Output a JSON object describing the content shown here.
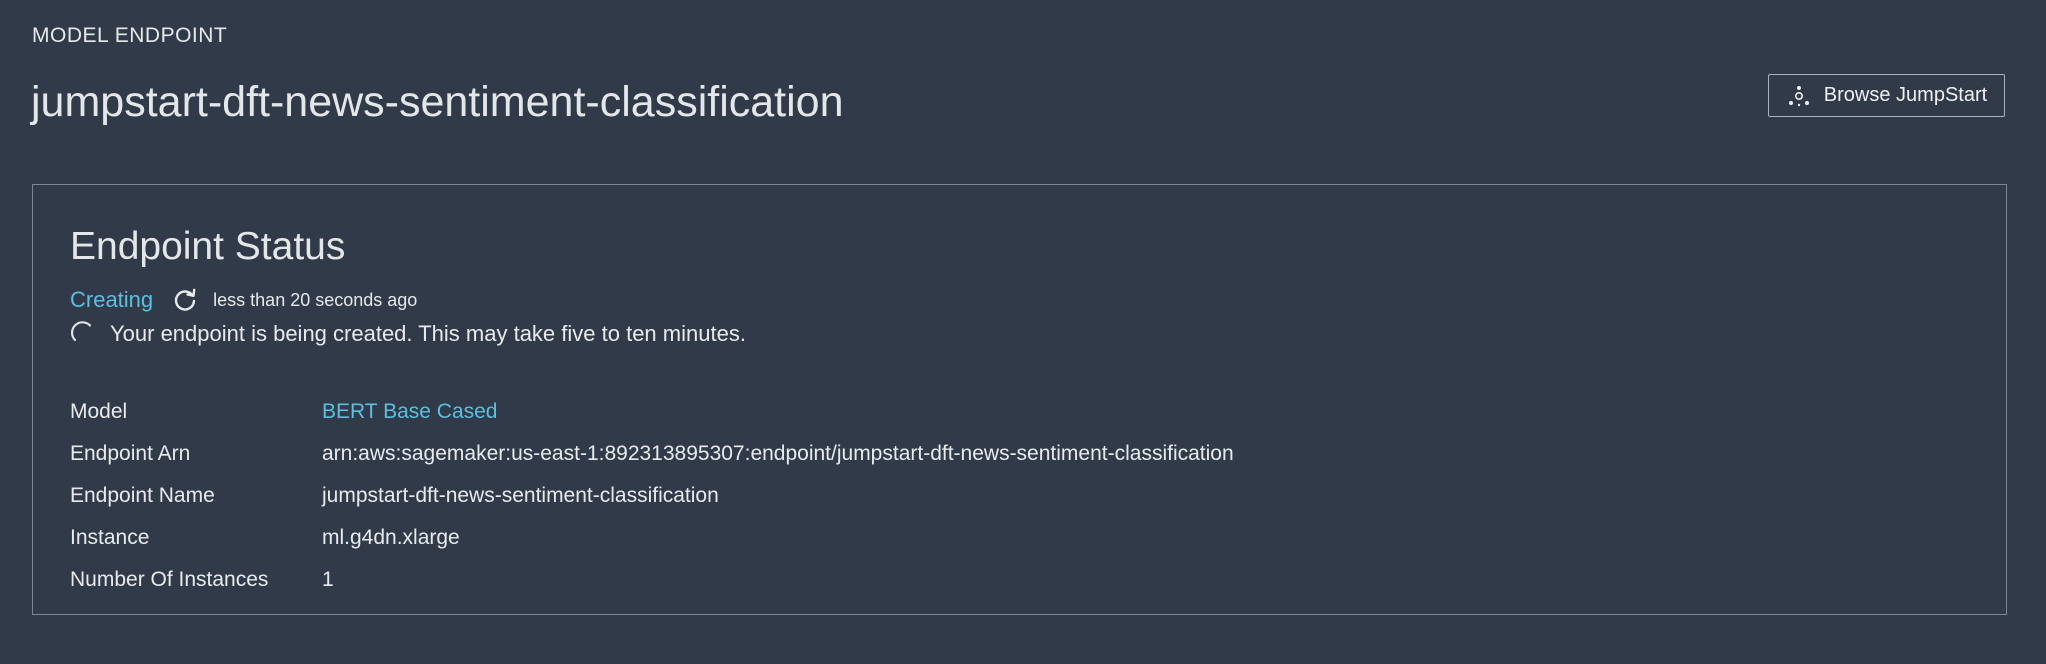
{
  "header": {
    "eyebrow": "MODEL ENDPOINT",
    "title": "jumpstart-dft-news-sentiment-classification",
    "browse_button": {
      "label": "Browse JumpStart",
      "icon": "jumpstart-icon"
    }
  },
  "endpoint_status": {
    "title": "Endpoint Status",
    "status": "Creating",
    "status_color": "#5bbfe0",
    "refresh_icon": "refresh-icon",
    "updated": "less than 20 seconds ago",
    "spinner_icon": "spinner-icon",
    "message": "Your endpoint is being created. This may take five to ten minutes."
  },
  "details": [
    {
      "label": "Model",
      "value": "BERT Base Cased",
      "is_link": true
    },
    {
      "label": "Endpoint Arn",
      "value": "arn:aws:sagemaker:us-east-1:892313895307:endpoint/jumpstart-dft-news-sentiment-classification",
      "is_link": false
    },
    {
      "label": "Endpoint Name",
      "value": "jumpstart-dft-news-sentiment-classification",
      "is_link": false
    },
    {
      "label": "Instance",
      "value": "ml.g4dn.xlarge",
      "is_link": false
    },
    {
      "label": "Number Of Instances",
      "value": "1",
      "is_link": false
    }
  ],
  "colors": {
    "background": "#303a48",
    "accent": "#5bbfe0",
    "border": "#7d8691"
  }
}
